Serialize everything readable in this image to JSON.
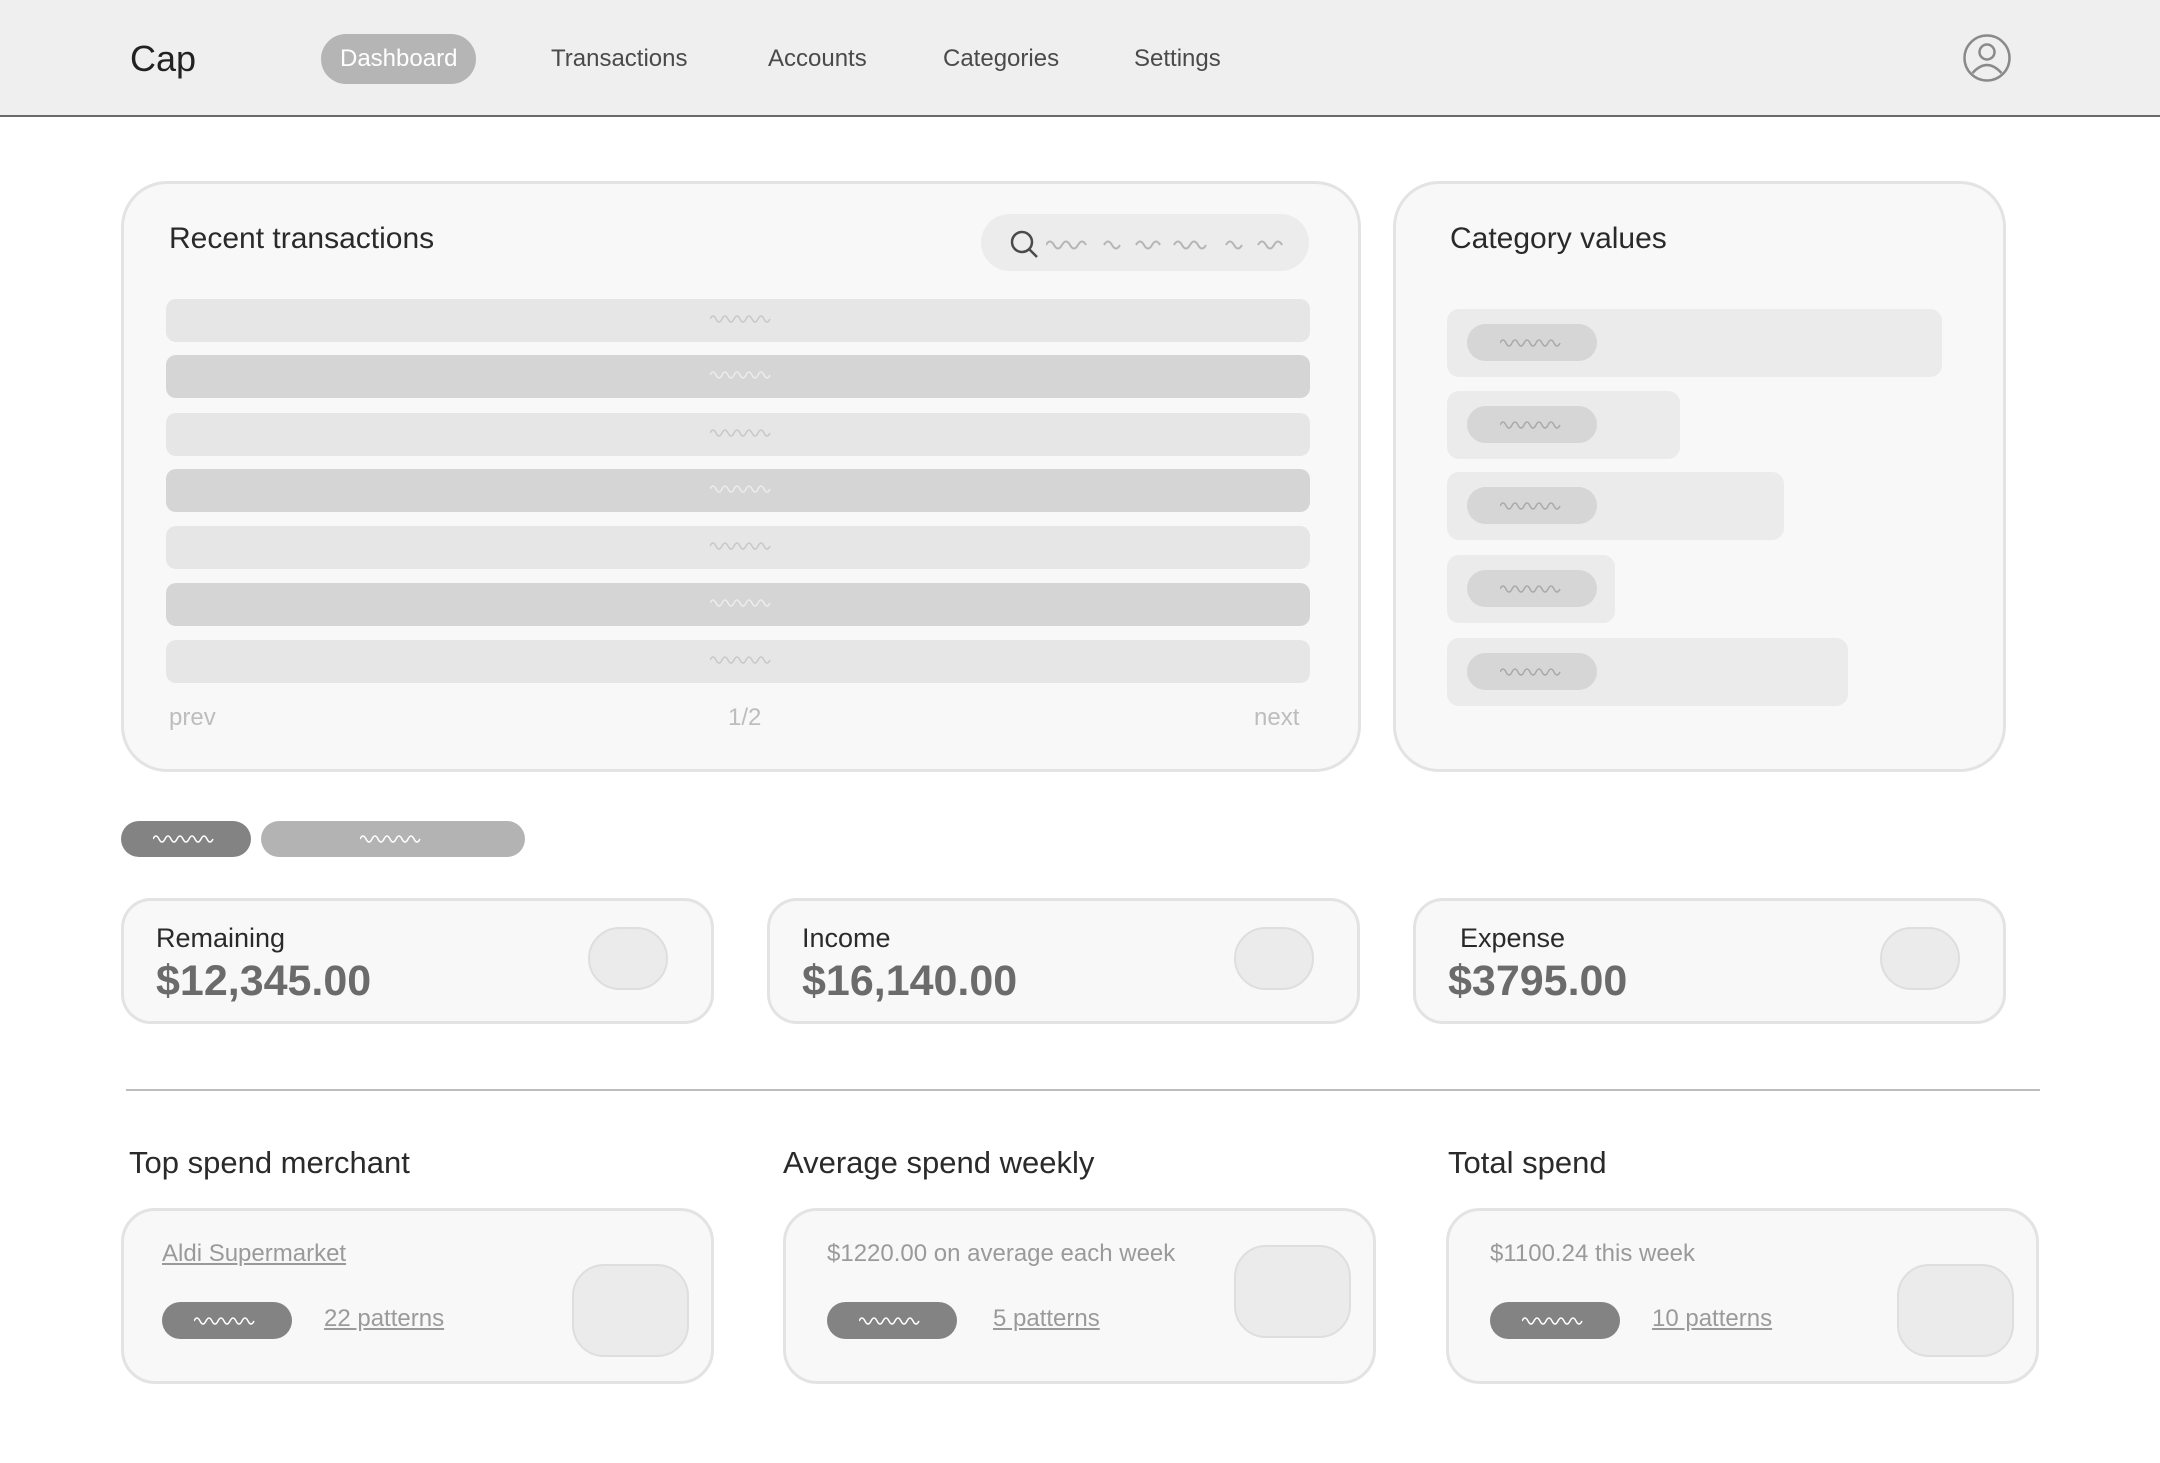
{
  "header": {
    "logo": "Cap",
    "nav": [
      {
        "label": "Dashboard",
        "active": true
      },
      {
        "label": "Transactions",
        "active": false
      },
      {
        "label": "Accounts",
        "active": false
      },
      {
        "label": "Categories",
        "active": false
      },
      {
        "label": "Settings",
        "active": false
      }
    ],
    "avatar_icon": "user-circle-icon"
  },
  "recent_transactions": {
    "title": "Recent transactions",
    "search_icon": "search-icon",
    "rows_count": 7,
    "pager": {
      "prev": "prev",
      "page": "1/2",
      "next": "next"
    }
  },
  "category_values": {
    "title": "Category values",
    "bar_levels": [
      1.0,
      0.47,
      0.68,
      0.34,
      0.81
    ]
  },
  "stats": [
    {
      "label": "Remaining",
      "value": "$12,345.00"
    },
    {
      "label": "Income",
      "value": "$16,140.00"
    },
    {
      "label": "Expense",
      "value": "$3795.00"
    }
  ],
  "insights": [
    {
      "title": "Top spend merchant",
      "text": "Aldi Supermarket",
      "patterns": "22 patterns"
    },
    {
      "title": "Average spend weekly",
      "text": "$1220.00 on average each week",
      "patterns": "5 patterns"
    },
    {
      "title": "Total spend",
      "text": "$1100.24 this week",
      "patterns": "10 patterns"
    }
  ],
  "colors": {
    "header_bg": "#efefef",
    "card_bg": "#f8f8f8",
    "active_nav": "#b5b5b5",
    "value_text": "#6b6b6b"
  }
}
